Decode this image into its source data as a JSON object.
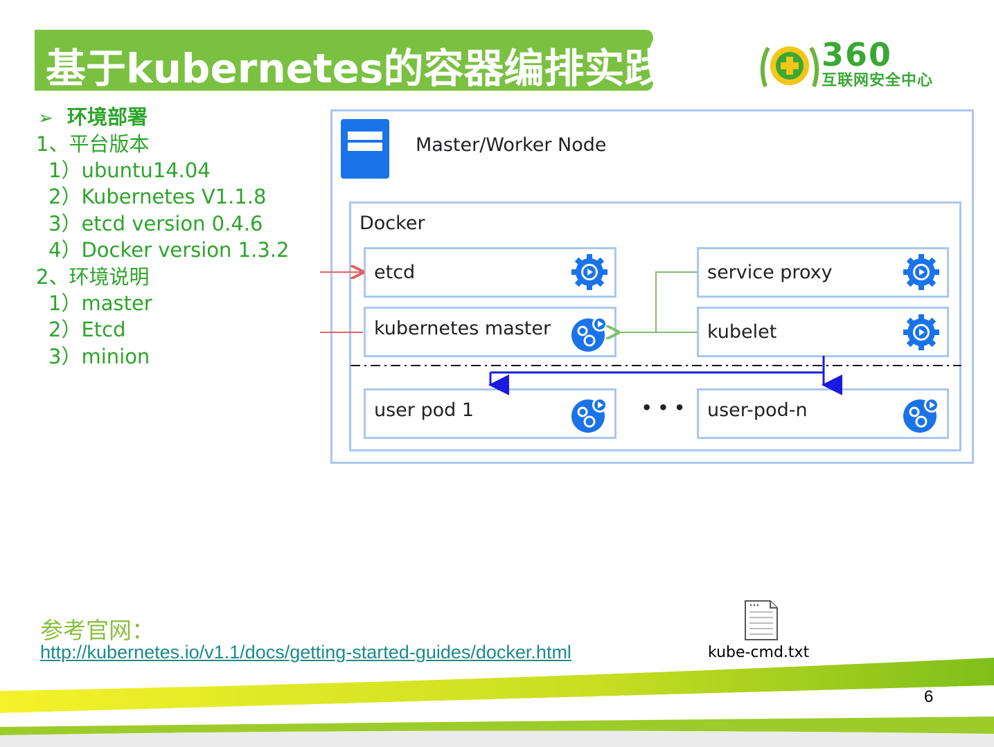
{
  "title": "基于kubernetes的容器编排实践",
  "logo": {
    "number": "360",
    "subtitle": "互联网安全中心"
  },
  "colors": {
    "green": "#2ca52a",
    "title_bg": "#7ac142",
    "diagram_border": "#a9c7f0",
    "arrow_red": "#e5605f",
    "arrow_green": "#7fbf6f",
    "arrow_blue": "#1a1ae0"
  },
  "content": {
    "heading": "环境部署",
    "section1": {
      "label": "1、平台版本",
      "items": [
        "1）ubuntu14.04",
        "2）Kubernetes V1.1.8",
        "3）etcd version 0.4.6",
        "4）Docker version 1.3.2"
      ]
    },
    "section2": {
      "label": "2、环境说明",
      "items": [
        "1）master",
        "2）Etcd",
        "3）minion"
      ]
    }
  },
  "diagram": {
    "node_title": "Master/Worker Node",
    "docker_label": "Docker",
    "etcd": "etcd",
    "kubernetes_master": "kubernetes master",
    "service_proxy": "service proxy",
    "kubelet": "kubelet",
    "user_pod_1": "user pod 1",
    "ellipsis": "• • •",
    "user_pod_n": "user-pod-n"
  },
  "reference": {
    "label": "参考官网：",
    "url": "http://kubernetes.io/v1.1/docs/getting-started-guides/docker.html"
  },
  "attachment": {
    "file_name": "kube-cmd.txt",
    "icon": "text-file-icon"
  },
  "page_number": "6"
}
